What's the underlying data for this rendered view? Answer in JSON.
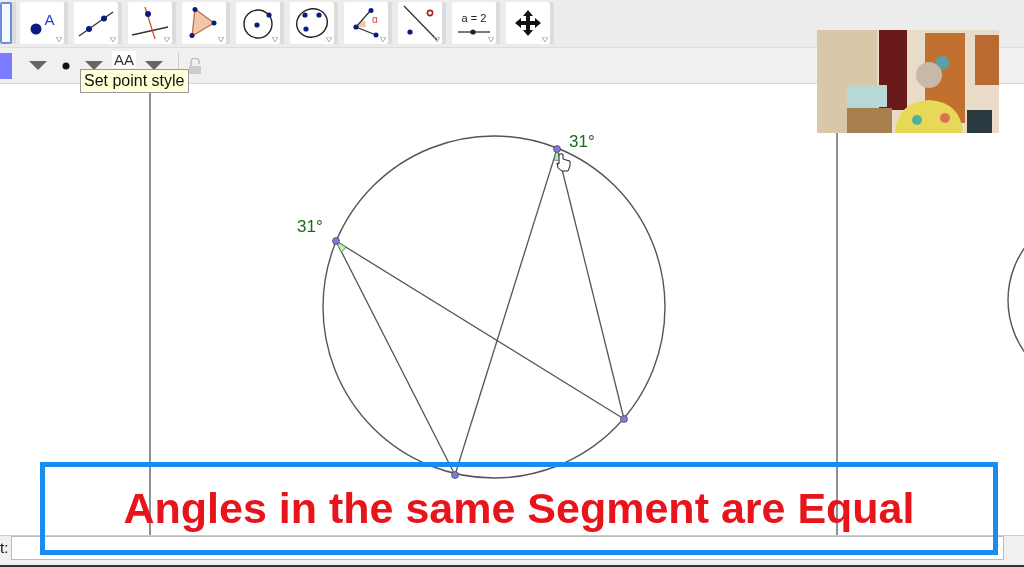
{
  "toolbar": {
    "tools": [
      {
        "kind": "move",
        "selected": true
      },
      {
        "kind": "point",
        "label": "A",
        "selected": false
      },
      {
        "kind": "line",
        "selected": false
      },
      {
        "kind": "perpendicular",
        "selected": false
      },
      {
        "kind": "polygon",
        "selected": false
      },
      {
        "kind": "circle",
        "selected": false
      },
      {
        "kind": "conic",
        "selected": false
      },
      {
        "kind": "angle",
        "label": "α",
        "selected": false
      },
      {
        "kind": "reflect",
        "selected": false
      },
      {
        "kind": "slider",
        "label": "a = 2",
        "selected": false
      },
      {
        "kind": "move-view",
        "selected": false
      }
    ]
  },
  "style_bar": {
    "color": "#7b7bff",
    "text_style": "AA",
    "tooltip": "Set point style"
  },
  "canvas": {
    "angle_labels": [
      "31°",
      "31°"
    ]
  },
  "caption": "Angles in the same Segment are Equal",
  "input_bar": {
    "label": "t:"
  }
}
